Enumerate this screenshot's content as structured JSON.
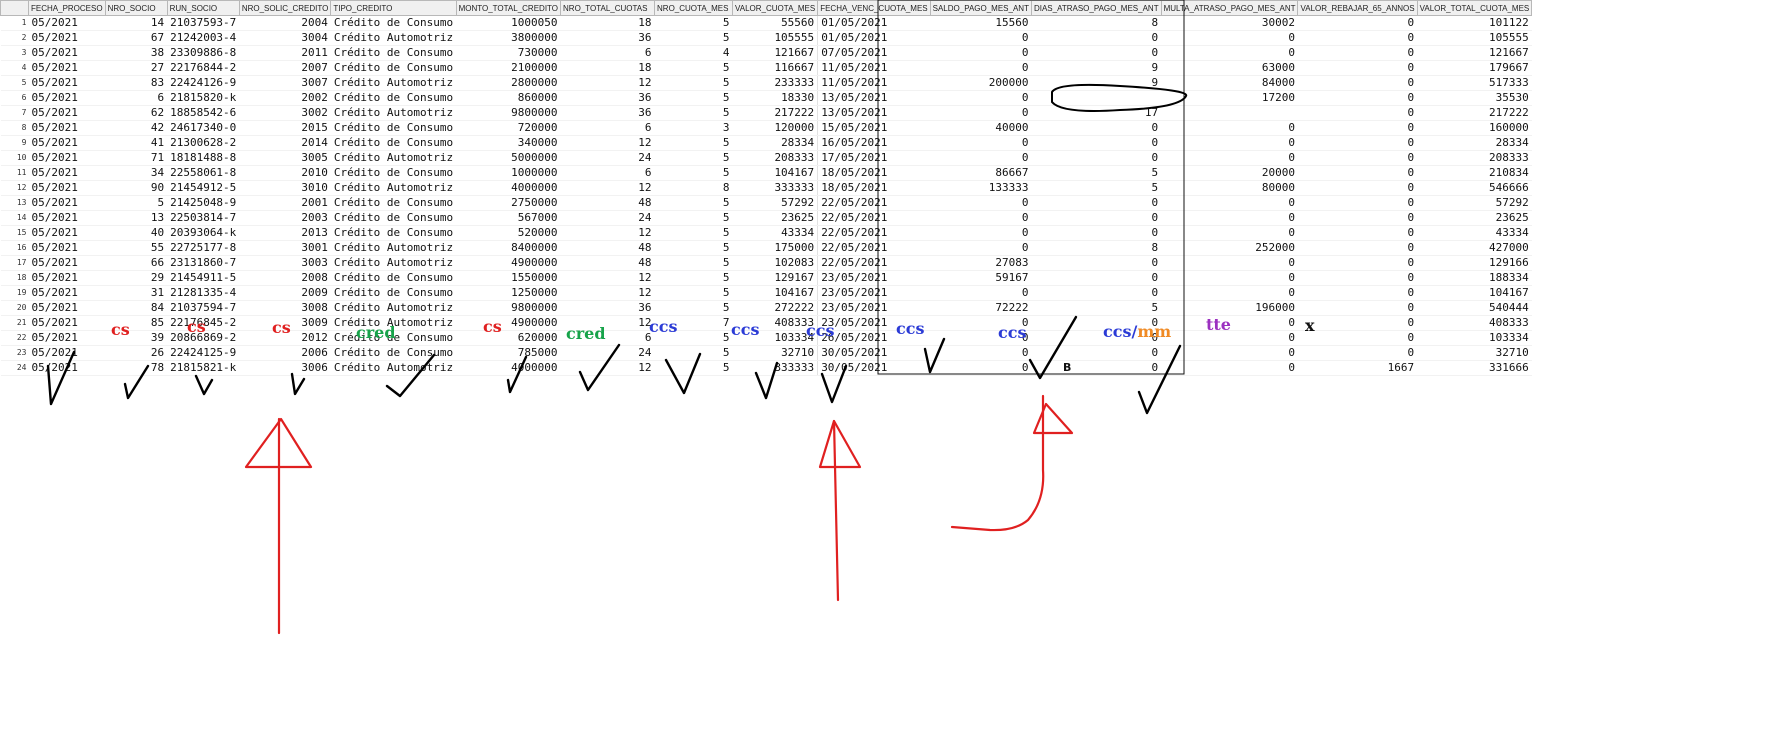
{
  "columns": [
    "",
    "FECHA_PROCESO",
    "NRO_SOCIO",
    "RUN_SOCIO",
    "NRO_SOLIC_CREDITO",
    "TIPO_CREDITO",
    "MONTO_TOTAL_CREDITO",
    "NRO_TOTAL_CUOTAS",
    "NRO_CUOTA_MES",
    "VALOR_CUOTA_MES",
    "FECHA_VENC_CUOTA_MES",
    "SALDO_PAGO_MES_ANT",
    "DIAS_ATRASO_PAGO_MES_ANT",
    "MULTA_ATRASO_PAGO_MES_ANT",
    "VALOR_REBAJAR_65_ANNOS",
    "VALOR_TOTAL_CUOTA_MES"
  ],
  "rows": [
    [
      "1",
      "05/2021",
      "14",
      "21037593-7",
      "2004",
      "Crédito de Consumo",
      "1000050",
      "18",
      "5",
      "55560",
      "01/05/2021",
      "15560",
      "8",
      "30002",
      "0",
      "101122"
    ],
    [
      "2",
      "05/2021",
      "67",
      "21242003-4",
      "3004",
      "Crédito Automotriz",
      "3800000",
      "36",
      "5",
      "105555",
      "01/05/2021",
      "0",
      "0",
      "0",
      "0",
      "105555"
    ],
    [
      "3",
      "05/2021",
      "38",
      "23309886-8",
      "2011",
      "Crédito de Consumo",
      "730000",
      "6",
      "4",
      "121667",
      "07/05/2021",
      "0",
      "0",
      "0",
      "0",
      "121667"
    ],
    [
      "4",
      "05/2021",
      "27",
      "22176844-2",
      "2007",
      "Crédito de Consumo",
      "2100000",
      "18",
      "5",
      "116667",
      "11/05/2021",
      "0",
      "9",
      "63000",
      "0",
      "179667"
    ],
    [
      "5",
      "05/2021",
      "83",
      "22424126-9",
      "3007",
      "Crédito Automotriz",
      "2800000",
      "12",
      "5",
      "233333",
      "11/05/2021",
      "200000",
      "9",
      "84000",
      "0",
      "517333"
    ],
    [
      "6",
      "05/2021",
      "6",
      "21815820-k",
      "2002",
      "Crédito de Consumo",
      "860000",
      "36",
      "5",
      "18330",
      "13/05/2021",
      "0",
      "",
      "17200",
      "0",
      "35530"
    ],
    [
      "7",
      "05/2021",
      "62",
      "18858542-6",
      "3002",
      "Crédito Automotriz",
      "9800000",
      "36",
      "5",
      "217222",
      "13/05/2021",
      "0",
      "17",
      "",
      "0",
      "217222"
    ],
    [
      "8",
      "05/2021",
      "42",
      "24617340-0",
      "2015",
      "Crédito de Consumo",
      "720000",
      "6",
      "3",
      "120000",
      "15/05/2021",
      "40000",
      "0",
      "0",
      "0",
      "160000"
    ],
    [
      "9",
      "05/2021",
      "41",
      "21300628-2",
      "2014",
      "Crédito de Consumo",
      "340000",
      "12",
      "5",
      "28334",
      "16/05/2021",
      "0",
      "0",
      "0",
      "0",
      "28334"
    ],
    [
      "10",
      "05/2021",
      "71",
      "18181488-8",
      "3005",
      "Crédito Automotriz",
      "5000000",
      "24",
      "5",
      "208333",
      "17/05/2021",
      "0",
      "0",
      "0",
      "0",
      "208333"
    ],
    [
      "11",
      "05/2021",
      "34",
      "22558061-8",
      "2010",
      "Crédito de Consumo",
      "1000000",
      "6",
      "5",
      "104167",
      "18/05/2021",
      "86667",
      "5",
      "20000",
      "0",
      "210834"
    ],
    [
      "12",
      "05/2021",
      "90",
      "21454912-5",
      "3010",
      "Crédito Automotriz",
      "4000000",
      "12",
      "8",
      "333333",
      "18/05/2021",
      "133333",
      "5",
      "80000",
      "0",
      "546666"
    ],
    [
      "13",
      "05/2021",
      "5",
      "21425048-9",
      "2001",
      "Crédito de Consumo",
      "2750000",
      "48",
      "5",
      "57292",
      "22/05/2021",
      "0",
      "0",
      "0",
      "0",
      "57292"
    ],
    [
      "14",
      "05/2021",
      "13",
      "22503814-7",
      "2003",
      "Crédito de Consumo",
      "567000",
      "24",
      "5",
      "23625",
      "22/05/2021",
      "0",
      "0",
      "0",
      "0",
      "23625"
    ],
    [
      "15",
      "05/2021",
      "40",
      "20393064-k",
      "2013",
      "Crédito de Consumo",
      "520000",
      "12",
      "5",
      "43334",
      "22/05/2021",
      "0",
      "0",
      "0",
      "0",
      "43334"
    ],
    [
      "16",
      "05/2021",
      "55",
      "22725177-8",
      "3001",
      "Crédito Automotriz",
      "8400000",
      "48",
      "5",
      "175000",
      "22/05/2021",
      "0",
      "8",
      "252000",
      "0",
      "427000"
    ],
    [
      "17",
      "05/2021",
      "66",
      "23131860-7",
      "3003",
      "Crédito Automotriz",
      "4900000",
      "48",
      "5",
      "102083",
      "22/05/2021",
      "27083",
      "0",
      "0",
      "0",
      "129166"
    ],
    [
      "18",
      "05/2021",
      "29",
      "21454911-5",
      "2008",
      "Crédito de Consumo",
      "1550000",
      "12",
      "5",
      "129167",
      "23/05/2021",
      "59167",
      "0",
      "0",
      "0",
      "188334"
    ],
    [
      "19",
      "05/2021",
      "31",
      "21281335-4",
      "2009",
      "Crédito de Consumo",
      "1250000",
      "12",
      "5",
      "104167",
      "23/05/2021",
      "0",
      "0",
      "0",
      "0",
      "104167"
    ],
    [
      "20",
      "05/2021",
      "84",
      "21037594-7",
      "3008",
      "Crédito Automotriz",
      "9800000",
      "36",
      "5",
      "272222",
      "23/05/2021",
      "72222",
      "5",
      "196000",
      "0",
      "540444"
    ],
    [
      "21",
      "05/2021",
      "85",
      "22176845-2",
      "3009",
      "Crédito Automotriz",
      "4900000",
      "12",
      "7",
      "408333",
      "23/05/2021",
      "0",
      "0",
      "0",
      "0",
      "408333"
    ],
    [
      "22",
      "05/2021",
      "39",
      "20866869-2",
      "2012",
      "Crédito de Consumo",
      "620000",
      "6",
      "5",
      "103334",
      "26/05/2021",
      "0",
      "0",
      "0",
      "0",
      "103334"
    ],
    [
      "23",
      "05/2021",
      "26",
      "22424125-9",
      "2006",
      "Crédito de Consumo",
      "785000",
      "24",
      "5",
      "32710",
      "30/05/2021",
      "0",
      "0",
      "0",
      "0",
      "32710"
    ],
    [
      "24",
      "05/2021",
      "78",
      "21815821-k",
      "3006",
      "Crédito Automotriz",
      "4000000",
      "12",
      "5",
      "333333",
      "30/05/2021",
      "0",
      "0",
      "0",
      "1667",
      "331666"
    ]
  ],
  "annotations": {
    "labels": {
      "nro_socio": "cs",
      "run_socio": "cs",
      "nro_solic": "cs",
      "tipo_credito": "cred",
      "monto_total": "cs",
      "nro_total_cuotas": "cred",
      "nro_cuota_mes": "ccs",
      "valor_cuota_mes": "ccs",
      "fecha_venc": "ccs",
      "saldo_pago": "ccs",
      "dias_atraso": "ccs",
      "multa_atraso_a": "ccs",
      "multa_atraso_sep": "/",
      "multa_atraso_b": "mm",
      "valor_rebajar": "tte",
      "valor_total": "x",
      "small_b": "B"
    },
    "colors": {
      "red": "#e02020",
      "green": "#17a34a",
      "blue": "#2b3bd6",
      "orange": "#f08a24",
      "purple": "#9b30c0",
      "black": "#111111"
    }
  }
}
